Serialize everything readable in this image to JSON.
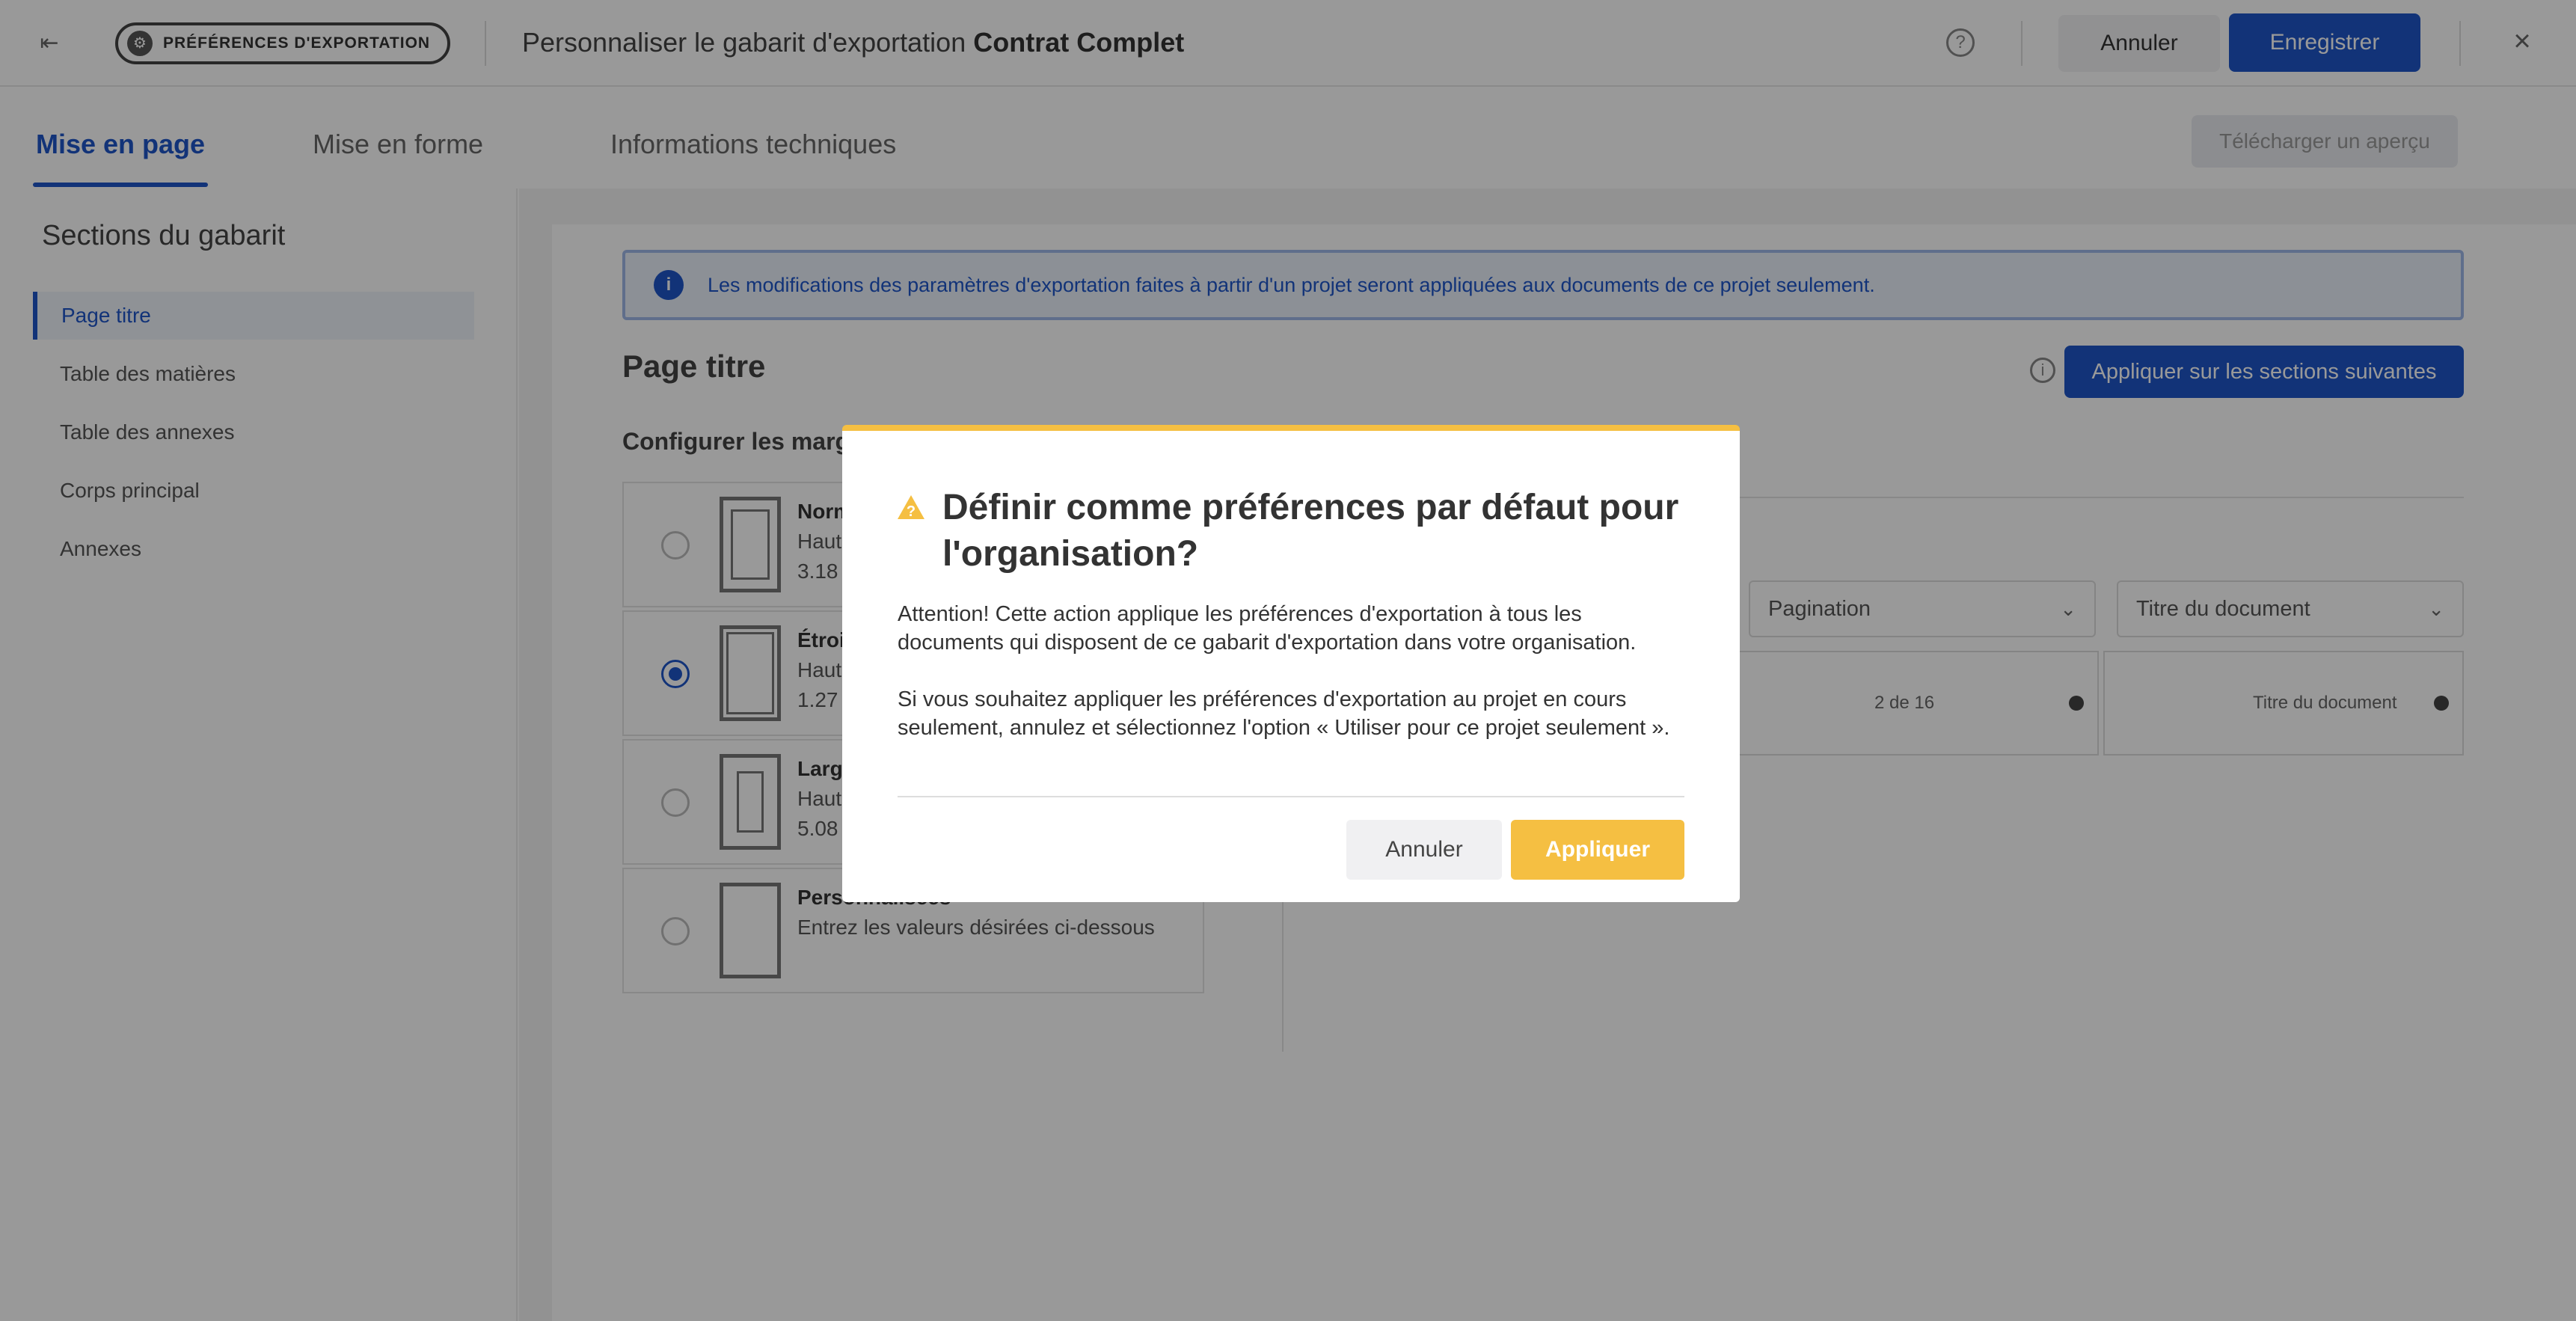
{
  "header": {
    "pill_label": "PRÉFÉRENCES D'EXPORTATION",
    "title_prefix": "Personnaliser le gabarit d'exportation",
    "title_template": "Contrat Complet",
    "cancel_label": "Annuler",
    "save_label": "Enregistrer"
  },
  "tabs": [
    {
      "label": "Mise en page",
      "active": true
    },
    {
      "label": "Mise en forme",
      "active": false
    },
    {
      "label": "Informations techniques",
      "active": false
    }
  ],
  "download_preview_label": "Télécharger un aperçu",
  "sidebar": {
    "title": "Sections du gabarit",
    "items": [
      {
        "label": "Page titre",
        "active": true
      },
      {
        "label": "Table des matières",
        "active": false
      },
      {
        "label": "Table des annexes",
        "active": false
      },
      {
        "label": "Corps principal",
        "active": false
      },
      {
        "label": "Annexes",
        "active": false
      }
    ]
  },
  "main": {
    "info_banner": "Les modifications des paramètres d'exportation faites à partir d'un projet seront appliquées aux documents de ce projet seulement.",
    "section_title": "Page titre",
    "apply_next_label": "Appliquer sur les sections suivantes",
    "margins_heading": "Configurer les marges",
    "margin_options": [
      {
        "name": "Normales",
        "line1": "Haut",
        "line2": "3.18",
        "selected": false
      },
      {
        "name": "Étroites",
        "line1": "Haut",
        "line2": "1.27",
        "selected": true
      },
      {
        "name": "Larges",
        "line1": "Haut",
        "line2": "5.08",
        "selected": false
      },
      {
        "name": "Personnalisées",
        "line1": "Entrez les valeurs désirées ci-dessous",
        "line2": "",
        "selected": false
      }
    ],
    "footer_selects": [
      "Pagination",
      "Titre du document"
    ],
    "preview": {
      "pagination": "2 de 16",
      "doc_title": "Titre du document"
    },
    "partial_text": "e"
  },
  "modal": {
    "title": "Définir comme préférences par défaut pour l'organisation?",
    "paragraph1": "Attention! Cette action applique les préférences d'exportation à tous les documents qui disposent de ce gabarit d'exportation dans votre organisation.",
    "paragraph2": "Si vous souhaitez appliquer les préférences d'exportation au projet en cours seulement, annulez et sélectionnez l'option « Utiliser pour ce projet seulement ».",
    "cancel_label": "Annuler",
    "apply_label": "Appliquer"
  },
  "colors": {
    "primary": "#1e56c9",
    "warning": "#f5bf42"
  }
}
